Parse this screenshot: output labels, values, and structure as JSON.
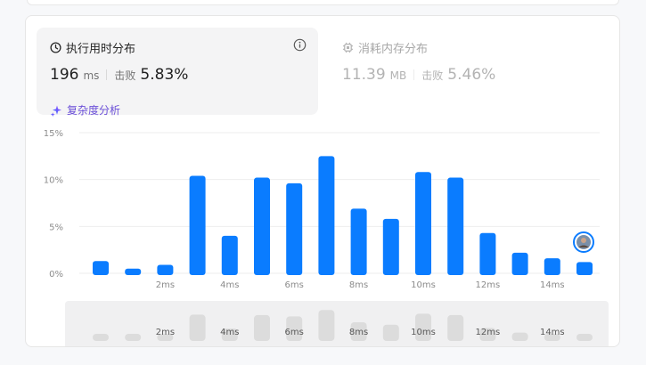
{
  "runtime_panel": {
    "title": "执行用时分布",
    "value": "196",
    "unit": "ms",
    "beat_label": "击败",
    "beat_percent": "5.83%",
    "complexity_link": "复杂度分析",
    "active": true
  },
  "memory_panel": {
    "title": "消耗内存分布",
    "value": "11.39",
    "unit": "MB",
    "beat_label": "击败",
    "beat_percent": "5.46%",
    "active": false
  },
  "colors": {
    "bar": "#0a7cff",
    "grid": "#eeeeee",
    "mini_bar": "#dcdcdc",
    "complexity_link": "#6b4fd8",
    "avatar_ring": "#0a7cff"
  },
  "icons": {
    "runtime": "clock-icon",
    "memory": "chip-icon",
    "info": "info-circle-icon",
    "complexity": "sparkle-icon"
  },
  "chart_data": {
    "type": "bar",
    "y_ticks": [
      "15%",
      "10%",
      "5%",
      "0%"
    ],
    "ylim": [
      0,
      15
    ],
    "x_tick_labels": [
      "2ms",
      "4ms",
      "6ms",
      "8ms",
      "10ms",
      "12ms",
      "14ms"
    ],
    "x_tick_bins": [
      2,
      4,
      6,
      8,
      10,
      12,
      14
    ],
    "values": [
      1.3,
      0.5,
      0.9,
      10.4,
      4.0,
      10.2,
      9.6,
      12.5,
      6.9,
      5.8,
      10.8,
      10.2,
      4.3,
      2.2,
      1.6,
      1.2
    ],
    "highlight_bin": 15,
    "grid": true
  },
  "mini_chart": {
    "x_tick_labels": [
      "2ms",
      "4ms",
      "6ms",
      "8ms",
      "10ms",
      "12ms",
      "14ms"
    ],
    "values": [
      1.3,
      0.5,
      0.9,
      10.4,
      4.0,
      10.2,
      9.6,
      12.5,
      6.9,
      5.8,
      10.8,
      10.2,
      4.3,
      2.2,
      1.6,
      1.2
    ]
  }
}
